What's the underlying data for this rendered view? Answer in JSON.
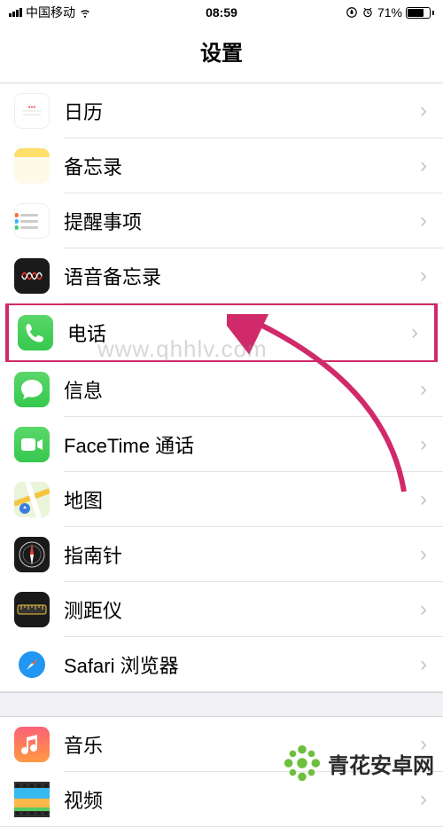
{
  "status_bar": {
    "carrier": "中国移动",
    "time": "08:59",
    "battery_percent": "71%"
  },
  "header": {
    "title": "设置"
  },
  "groups": [
    {
      "items": [
        {
          "key": "calendar",
          "label": "日历",
          "name": "row-calendar",
          "icon": "calendar-icon"
        },
        {
          "key": "notes",
          "label": "备忘录",
          "name": "row-notes",
          "icon": "notes-icon"
        },
        {
          "key": "reminders",
          "label": "提醒事项",
          "name": "row-reminders",
          "icon": "reminders-icon"
        },
        {
          "key": "voicememos",
          "label": "语音备忘录",
          "name": "row-voice-memos",
          "icon": "voice-memos-icon"
        },
        {
          "key": "phone",
          "label": "电话",
          "name": "row-phone",
          "icon": "phone-icon",
          "highlighted": true
        },
        {
          "key": "messages",
          "label": "信息",
          "name": "row-messages",
          "icon": "messages-icon"
        },
        {
          "key": "facetime",
          "label": "FaceTime 通话",
          "name": "row-facetime",
          "icon": "facetime-icon"
        },
        {
          "key": "maps",
          "label": "地图",
          "name": "row-maps",
          "icon": "maps-icon"
        },
        {
          "key": "compass",
          "label": "指南针",
          "name": "row-compass",
          "icon": "compass-icon"
        },
        {
          "key": "measure",
          "label": "测距仪",
          "name": "row-measure",
          "icon": "measure-icon"
        },
        {
          "key": "safari",
          "label": "Safari 浏览器",
          "name": "row-safari",
          "icon": "safari-icon"
        }
      ]
    },
    {
      "items": [
        {
          "key": "music",
          "label": "音乐",
          "name": "row-music",
          "icon": "music-icon"
        },
        {
          "key": "video",
          "label": "视频",
          "name": "row-video",
          "icon": "video-icon"
        }
      ]
    }
  ],
  "annotation": {
    "highlight_color": "#d12a6a",
    "arrow_color": "#d12a6a"
  },
  "watermark": {
    "url_text": "www.qhhlv.com",
    "brand_text": "青花安卓网"
  }
}
